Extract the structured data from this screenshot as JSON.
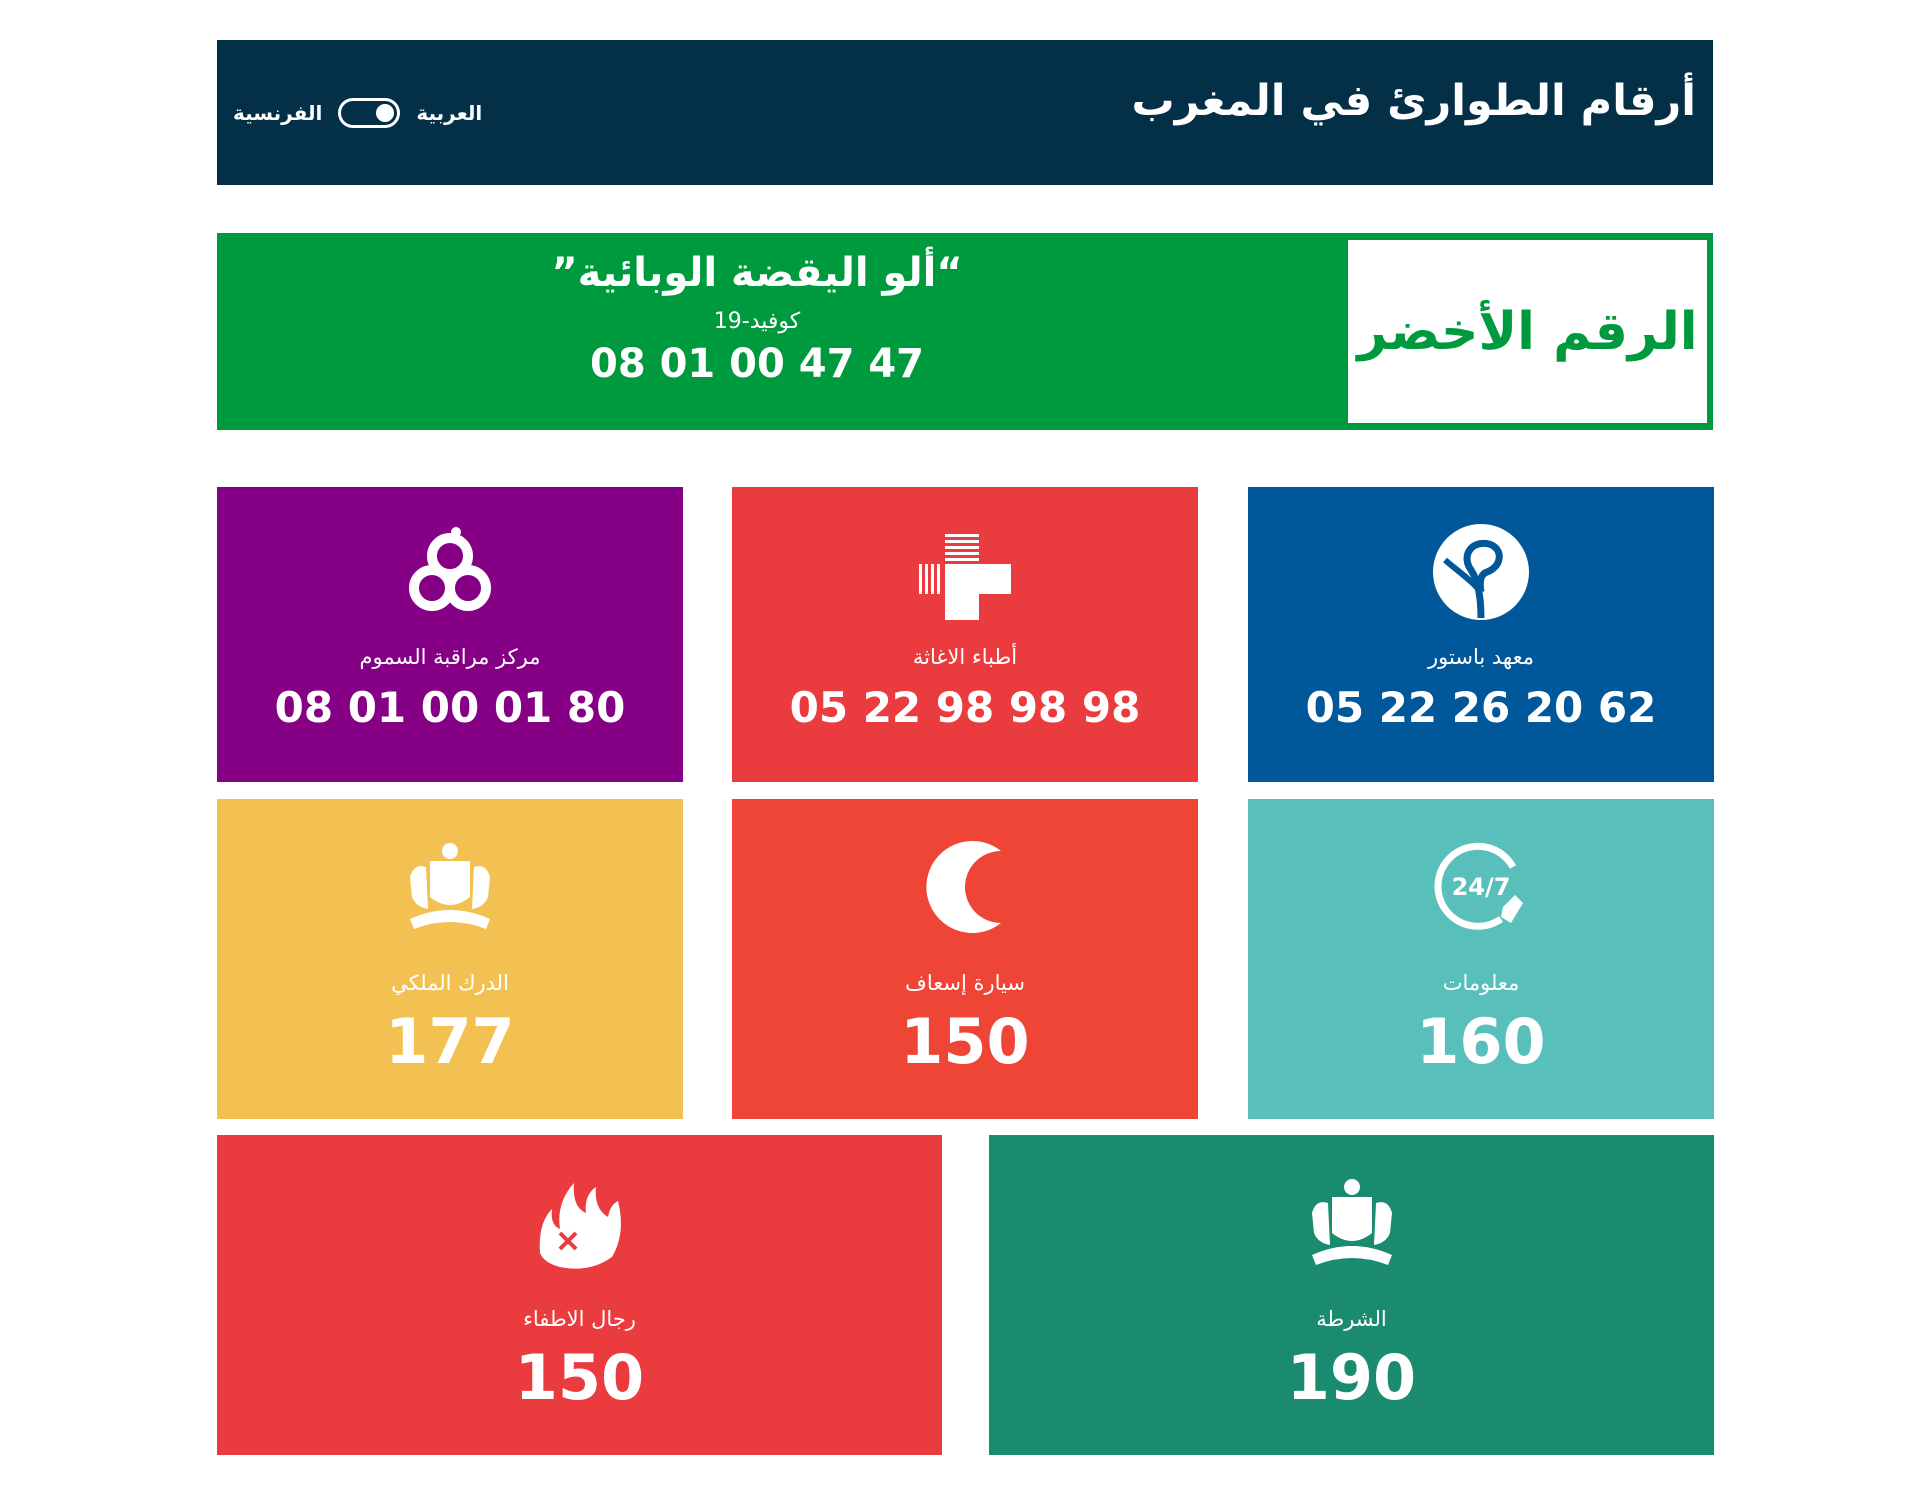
{
  "header": {
    "title": "أرقام الطوارئ في المغرب",
    "lang_arabic": "العربية",
    "lang_french": "الفرنسية"
  },
  "green": {
    "title": "الرقم الأخضر",
    "name": "“ألو اليقضة الوبائية”",
    "sub": "كوفيد-19",
    "number": "08 01 00 47 47"
  },
  "cards": {
    "pasteur": {
      "label": "معهد باستور",
      "number": "05 22 26 20 62",
      "color": "#00579a"
    },
    "urgence": {
      "label": "أطباء الاغاثة",
      "number": "05 22 98 98 98",
      "color": "#ea3c3f"
    },
    "poison": {
      "label": "مركز مراقبة السموم",
      "number": "08 01 00 01 80",
      "color": "#850085"
    },
    "info": {
      "label": "معلومات",
      "number": "160",
      "color": "#58bfbb"
    },
    "ambulance": {
      "label": "سيارة إسعاف",
      "number": "150",
      "color": "#ef4536"
    },
    "gendarmerie": {
      "label": "الدرك الملكي",
      "number": "177",
      "color": "#f3c152"
    },
    "police": {
      "label": "الشرطة",
      "number": "190",
      "color": "#1a8b6e"
    },
    "pompiers": {
      "label": "رجال الاطفاء",
      "number": "150",
      "color": "#ea3c3f"
    }
  }
}
